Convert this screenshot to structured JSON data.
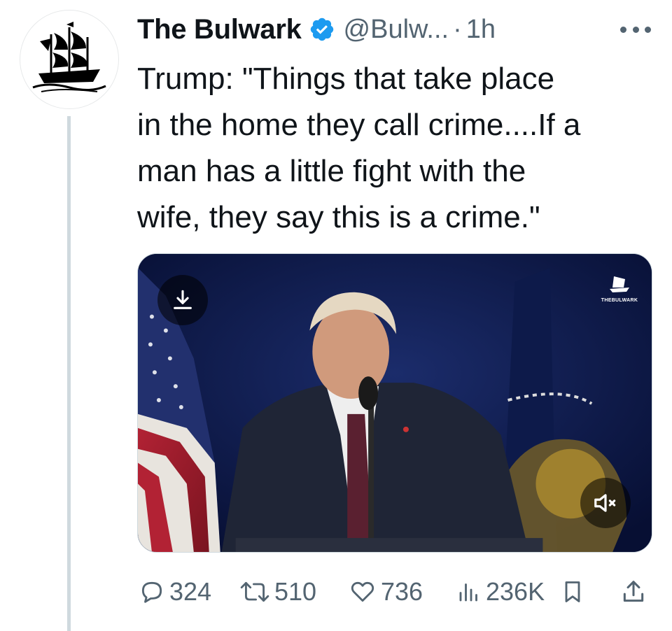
{
  "tweet": {
    "author_name": "The Bulwark",
    "handle": "@Bulw...",
    "separator": "·",
    "time": "1h",
    "verified": true,
    "text": "Trump: \"Things that take place\nin the home they call crime....If a\nman has a little fight with the\nwife, they say this is a crime.\"",
    "media": {
      "type": "video",
      "watermark": "THEBULWARK",
      "download_icon": "download-icon",
      "mute_icon": "speaker-muted-icon"
    }
  },
  "actions": {
    "replies": "324",
    "retweets": "510",
    "likes": "736",
    "views": "236K"
  },
  "colors": {
    "text": "#0f1419",
    "secondary": "#536471",
    "verified_badge": "#1d9bf0",
    "thread_line": "#cfd9de"
  }
}
